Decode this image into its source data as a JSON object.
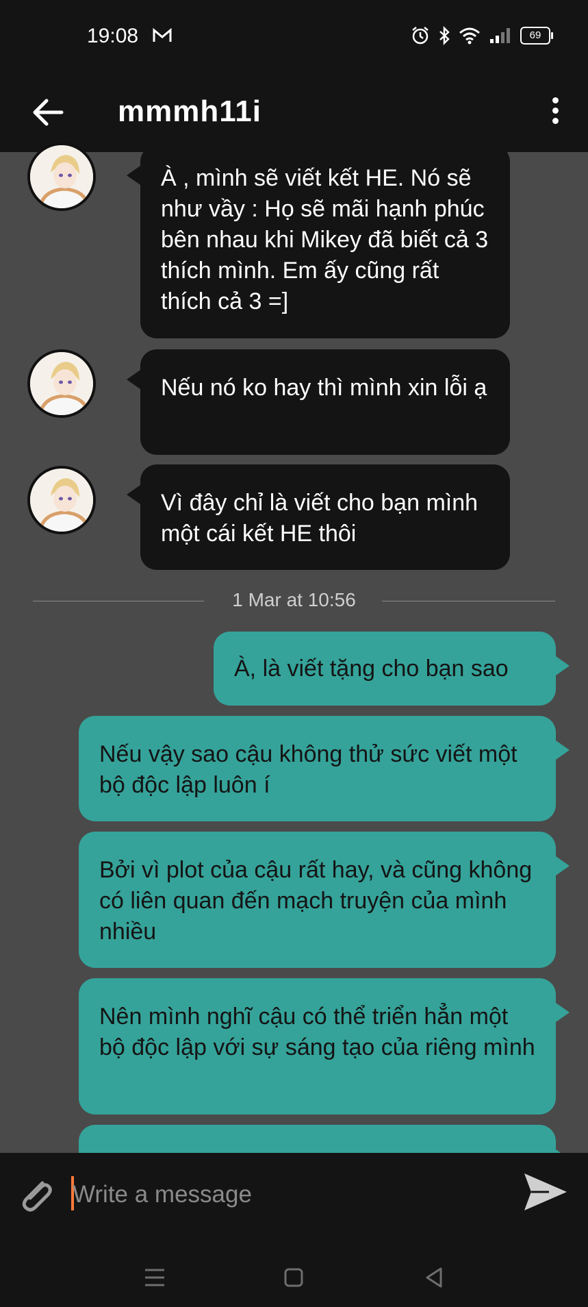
{
  "status_bar": {
    "time": "19:08",
    "battery": "69"
  },
  "header": {
    "title": "mmmh11i"
  },
  "incoming": [
    {
      "text": "À , mình sẽ viết kết HE. Nó sẽ như vầy : Họ sẽ mãi hạnh phúc bên nhau khi Mikey đã biết cả 3 thích mình. Em ấy cũng rất thích cả 3 =]"
    },
    {
      "text": "Nếu nó ko hay thì mình xin lỗi ạ"
    },
    {
      "text": "Vì đây chỉ là viết cho bạn mình một cái kết HE thôi"
    }
  ],
  "date_separator": "1 Mar at 10:56",
  "outgoing": [
    {
      "text": "À, là viết tặng cho bạn sao"
    },
    {
      "text": "Nếu vậy sao cậu không thử sức viết một bộ độc lập luôn í"
    },
    {
      "text": "Bởi vì plot của cậu rất hay, và cũng không có liên quan đến mạch truyện của mình nhiều"
    },
    {
      "text": "Nên mình nghĩ cậu có thể triển hẳn một bộ độc lập với sự sáng tạo của riêng mình"
    }
  ],
  "composer": {
    "placeholder": "Write a message",
    "value": ""
  },
  "colors": {
    "incoming_bg": "#141414",
    "outgoing_bg": "#35a39a",
    "background": "#4a4a4a",
    "cursor": "#ff7a3c"
  }
}
